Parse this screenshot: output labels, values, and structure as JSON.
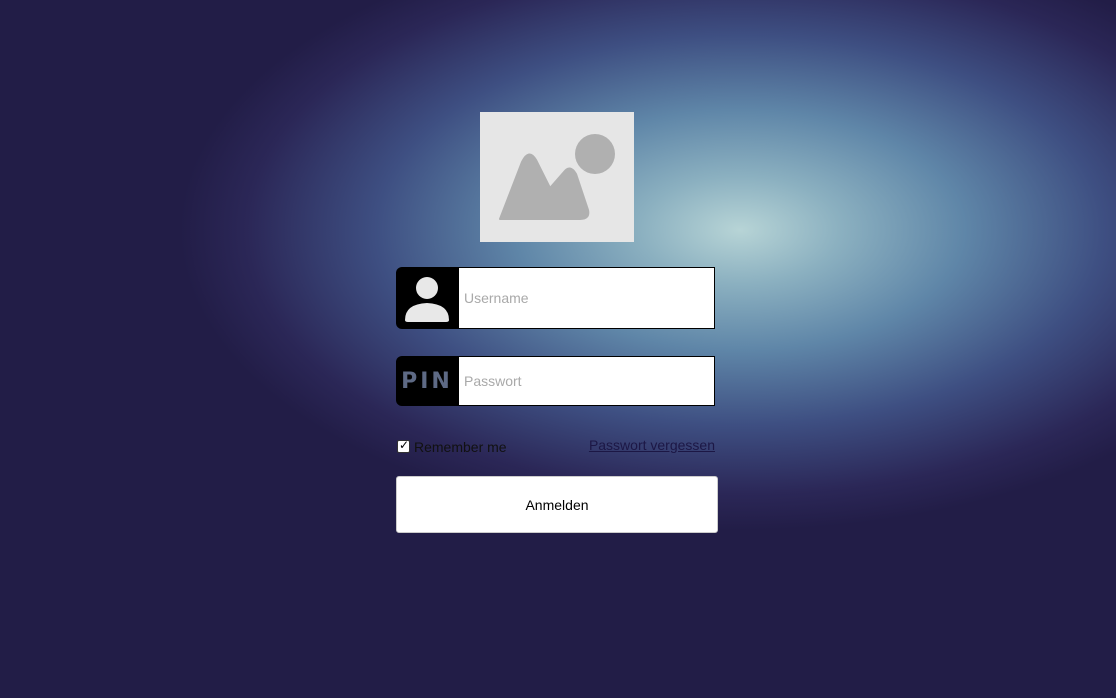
{
  "logo": {
    "icon": "image-placeholder-icon"
  },
  "username": {
    "placeholder": "Username",
    "value": "",
    "icon": "user-icon"
  },
  "password": {
    "placeholder": "Passwort",
    "value": "",
    "icon_text": "PIN"
  },
  "remember": {
    "label": "Remember me",
    "checked": true
  },
  "forgot_link": "Passwort vergessen",
  "login_button": "Anmelden",
  "colors": {
    "field_icon_bg": "#000000",
    "pin_text": "#5e6a85",
    "link": "#1c1745",
    "logo_bg": "#e6e6e6",
    "logo_glyph": "#b0b0b0"
  }
}
